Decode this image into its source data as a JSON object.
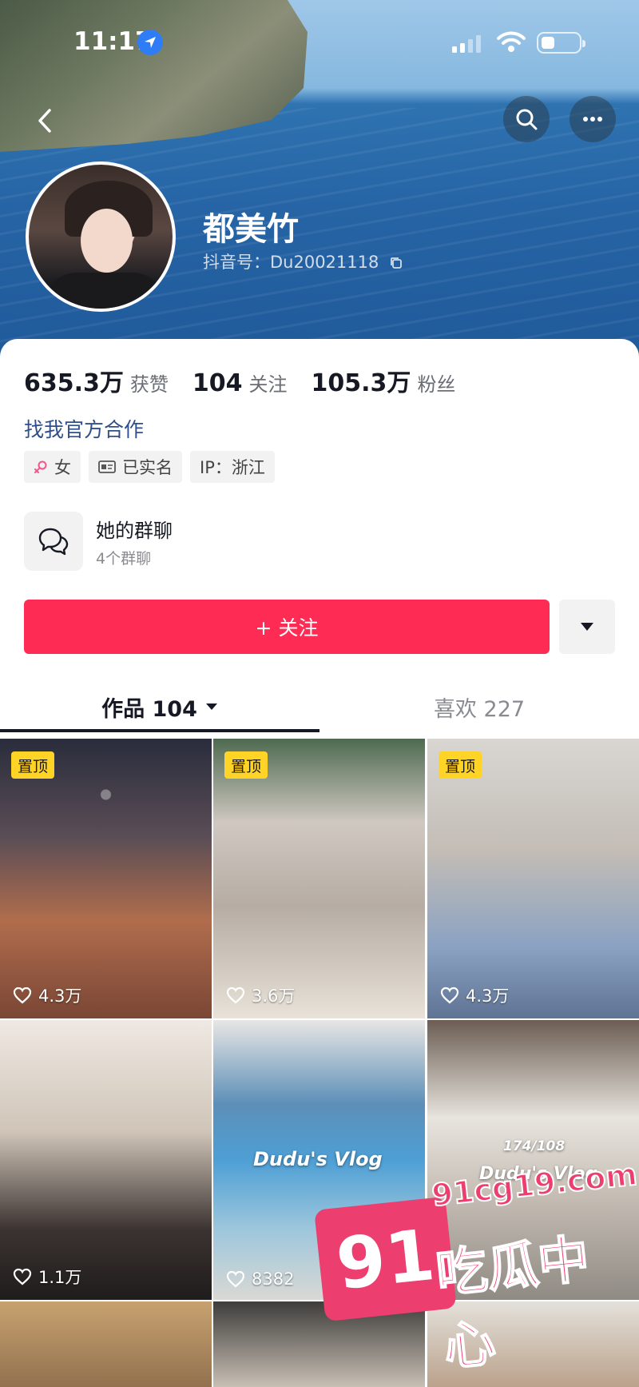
{
  "status_bar": {
    "time": "11:17"
  },
  "profile": {
    "name": "都美竹",
    "douyin_id": "抖音号：Du20021118"
  },
  "stats": [
    {
      "value": "635.3万",
      "label": "获赞"
    },
    {
      "value": "104",
      "label": "关注"
    },
    {
      "value": "105.3万",
      "label": "粉丝"
    }
  ],
  "cooperate_link": "找我官方合作",
  "tags": {
    "gender": "女",
    "verified": "已实名",
    "ip": "IP：浙江"
  },
  "group_chat": {
    "title": "她的群聊",
    "subtitle": "4个群聊"
  },
  "follow_button": "+ 关注",
  "tabs": {
    "works": "作品 104",
    "likes": "喜欢 227"
  },
  "videos": [
    {
      "pinned": "置顶",
      "likes": "4.3万"
    },
    {
      "pinned": "置顶",
      "likes": "3.6万"
    },
    {
      "pinned": "置顶",
      "likes": "4.3万"
    },
    {
      "likes": "1.1万"
    },
    {
      "likes": "8382",
      "overlay": "Dudu's Vlog"
    },
    {
      "overlay": "Dudu's Vlog",
      "overlay_count": "174/108"
    }
  ],
  "watermark": {
    "number": "91",
    "domain": "91cg19.com",
    "text": "吃瓜中心"
  },
  "colors": {
    "accent": "#fe2c55",
    "link": "#2f4f8c",
    "pin": "#ffd426"
  }
}
